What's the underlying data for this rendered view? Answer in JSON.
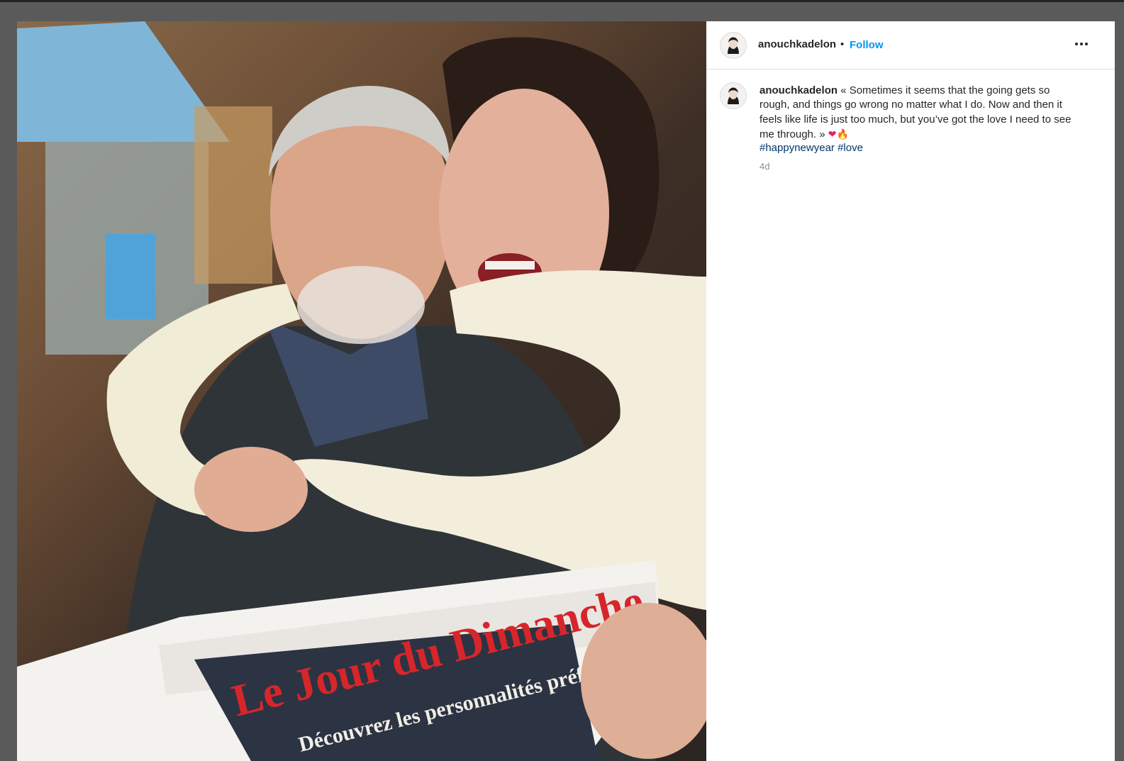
{
  "post": {
    "username": "anouchkadelon",
    "separator": "•",
    "follow_label": "Follow",
    "more_icon": "more-horizontal-icon",
    "caption_text": " « Sometimes it seems that the going gets so rough, and things go wrong no matter what I do. Now and then it feels like life is just too much, but you’ve got the love I need to see me through. » ",
    "emoji_heart": "❤",
    "emoji_fire": "🔥",
    "hashtags": [
      "#happynewyear",
      "#love"
    ],
    "timestamp": "4d"
  },
  "photo": {
    "newspaper_title": "Le Jour du Dimanche",
    "newspaper_headline": "Découvrez les personnalités préférées des Français"
  },
  "colors": {
    "follow_blue": "#0095f6",
    "hashtag_blue": "#00376b",
    "timestamp_gray": "#8e8e8e"
  }
}
